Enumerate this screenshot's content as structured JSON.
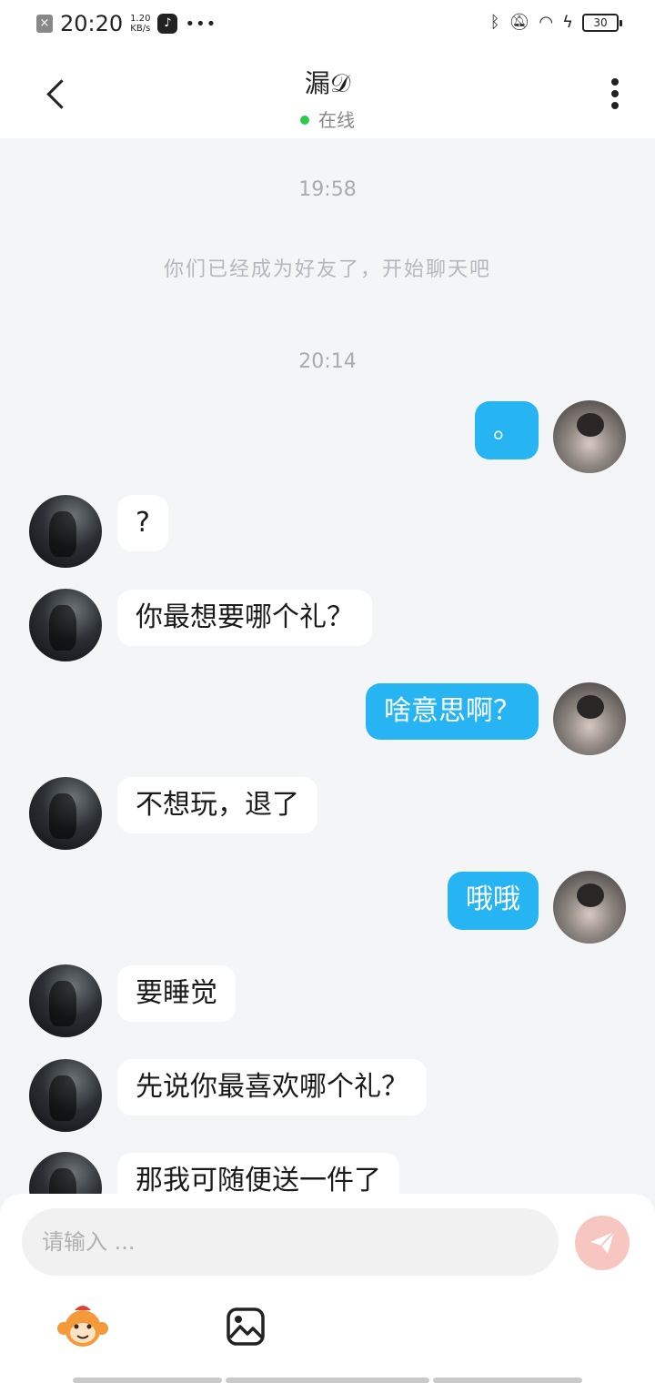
{
  "status_bar": {
    "time": "20:20",
    "net_speed_value": "1.20",
    "net_speed_unit": "KB/s",
    "battery": "30"
  },
  "header": {
    "title": "漏𝒟",
    "status": "在线"
  },
  "chat": {
    "timestamps": [
      "19:58",
      "20:14"
    ],
    "system_message": "你们已经成为好友了，开始聊天吧",
    "messages": [
      {
        "from": "me",
        "text": "。"
      },
      {
        "from": "her",
        "text": "?"
      },
      {
        "from": "her",
        "text": "你最想要哪个礼？"
      },
      {
        "from": "me",
        "text": "啥意思啊？"
      },
      {
        "from": "her",
        "text": "不想玩，退了"
      },
      {
        "from": "me",
        "text": "哦哦"
      },
      {
        "from": "her",
        "text": "要睡觉"
      },
      {
        "from": "her",
        "text": "先说你最喜欢哪个礼？"
      },
      {
        "from": "her",
        "text": "那我可随便送一件了"
      }
    ]
  },
  "input": {
    "placeholder": "请输入 ..."
  },
  "icons": {
    "send": "paper-plane-icon",
    "emoji": "monkey-emoji-icon",
    "image": "image-icon"
  },
  "colors": {
    "outgoing_bubble": "#27b4f3",
    "incoming_bubble": "#ffffff",
    "online_dot": "#2dc84d",
    "send_button": "#f7c6c1"
  }
}
